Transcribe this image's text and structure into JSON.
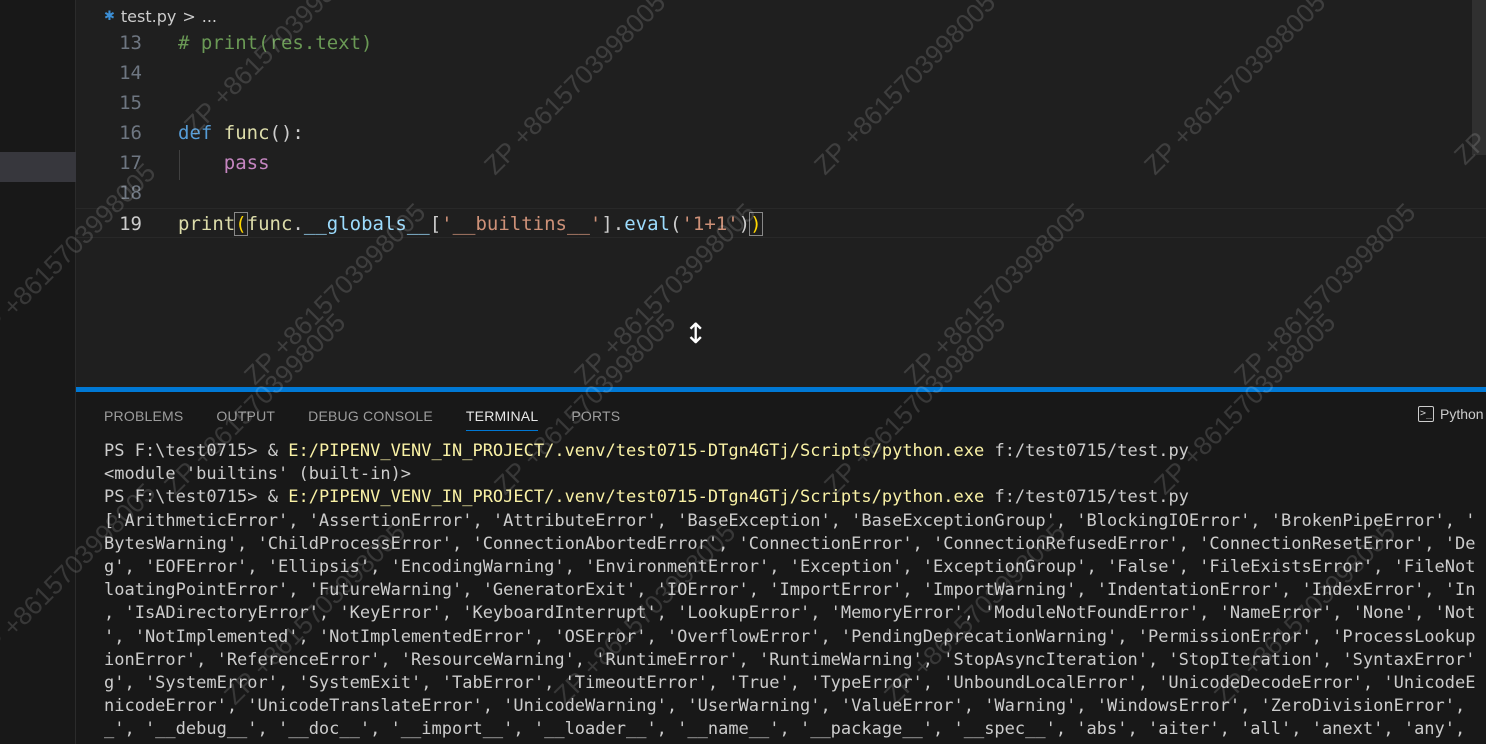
{
  "breadcrumb": {
    "file": "test.py",
    "separator": ">",
    "more": "..."
  },
  "editor": {
    "lines": [
      {
        "n": "13",
        "tokens": [
          {
            "c": "cm",
            "t": "# print(res.text)"
          }
        ]
      },
      {
        "n": "14",
        "tokens": []
      },
      {
        "n": "15",
        "tokens": []
      },
      {
        "n": "16",
        "tokens": [
          {
            "c": "kw",
            "t": "def"
          },
          {
            "c": "pn",
            "t": " "
          },
          {
            "c": "fn",
            "t": "func"
          },
          {
            "c": "pn",
            "t": "():"
          }
        ]
      },
      {
        "n": "17",
        "tokens": [
          {
            "c": "pn",
            "t": "    "
          },
          {
            "c": "pass",
            "t": "pass"
          }
        ]
      },
      {
        "n": "18",
        "tokens": []
      },
      {
        "n": "19",
        "current": true,
        "tokens": [
          {
            "c": "fn",
            "t": "print"
          },
          {
            "c": "br1",
            "t": "("
          },
          {
            "c": "fn",
            "t": "func"
          },
          {
            "c": "pn",
            "t": "."
          },
          {
            "c": "id",
            "t": "__globals__"
          },
          {
            "c": "pn",
            "t": "["
          },
          {
            "c": "st",
            "t": "'__builtins__'"
          },
          {
            "c": "pn",
            "t": "]."
          },
          {
            "c": "id",
            "t": "eval"
          },
          {
            "c": "pn",
            "t": "("
          },
          {
            "c": "st",
            "t": "'1+1'"
          },
          {
            "c": "pn",
            "t": ")"
          },
          {
            "c": "br1",
            "t": ")"
          }
        ]
      }
    ]
  },
  "panel": {
    "tabs": [
      "PROBLEMS",
      "OUTPUT",
      "DEBUG CONSOLE",
      "TERMINAL",
      "PORTS"
    ],
    "active_tab": "TERMINAL",
    "shell_label": "Python",
    "shell_icon": "terminal-icon"
  },
  "terminal": {
    "lines": [
      {
        "parts": [
          {
            "t": "PS F:\\test0715> & "
          },
          {
            "c": "yl",
            "t": "E:/PIPENV_VENV_IN_PROJECT/.venv/test0715-DTgn4GTj/Scripts/python.exe"
          },
          {
            "t": " f:/test0715/test.py"
          }
        ]
      },
      {
        "parts": [
          {
            "t": "<module 'builtins' (built-in)>"
          }
        ]
      },
      {
        "parts": [
          {
            "t": "PS F:\\test0715> & "
          },
          {
            "c": "yl",
            "t": "E:/PIPENV_VENV_IN_PROJECT/.venv/test0715-DTgn4GTj/Scripts/python.exe"
          },
          {
            "t": " f:/test0715/test.py"
          }
        ]
      },
      {
        "parts": [
          {
            "t": "['ArithmeticError', 'AssertionError', 'AttributeError', 'BaseException', 'BaseExceptionGroup', 'BlockingIOError', 'BrokenPipeError', '"
          }
        ]
      },
      {
        "parts": [
          {
            "t": "BytesWarning', 'ChildProcessError', 'ConnectionAbortedError', 'ConnectionError', 'ConnectionRefusedError', 'ConnectionResetError', 'De"
          }
        ]
      },
      {
        "parts": [
          {
            "t": "g', 'EOFError', 'Ellipsis', 'EncodingWarning', 'EnvironmentError', 'Exception', 'ExceptionGroup', 'False', 'FileExistsError', 'FileNot"
          }
        ]
      },
      {
        "parts": [
          {
            "t": "loatingPointError', 'FutureWarning', 'GeneratorExit', 'IOError', 'ImportError', 'ImportWarning', 'IndentationError', 'IndexError', 'In"
          }
        ]
      },
      {
        "parts": [
          {
            "t": ", 'IsADirectoryError', 'KeyError', 'KeyboardInterrupt', 'LookupError', 'MemoryError', 'ModuleNotFoundError', 'NameError', 'None', 'Not"
          }
        ]
      },
      {
        "parts": [
          {
            "t": "', 'NotImplemented', 'NotImplementedError', 'OSError', 'OverflowError', 'PendingDeprecationWarning', 'PermissionError', 'ProcessLookup"
          }
        ]
      },
      {
        "parts": [
          {
            "t": "ionError', 'ReferenceError', 'ResourceWarning', 'RuntimeError', 'RuntimeWarning', 'StopAsyncIteration', 'StopIteration', 'SyntaxError'"
          }
        ]
      },
      {
        "parts": [
          {
            "t": "g', 'SystemError', 'SystemExit', 'TabError', 'TimeoutError', 'True', 'TypeError', 'UnboundLocalError', 'UnicodeDecodeError', 'UnicodeE"
          }
        ]
      },
      {
        "parts": [
          {
            "t": "nicodeError', 'UnicodeTranslateError', 'UnicodeWarning', 'UserWarning', 'ValueError', 'Warning', 'WindowsError', 'ZeroDivisionError',"
          }
        ]
      },
      {
        "parts": [
          {
            "t": "_', '__debug__', '__doc__', '__import__', '__loader__', '__name__', '__package__', '__spec__', 'abs', 'aiter', 'all', 'anext', 'any',"
          }
        ]
      }
    ]
  },
  "watermark": {
    "text": "ZP +8615703998005"
  }
}
